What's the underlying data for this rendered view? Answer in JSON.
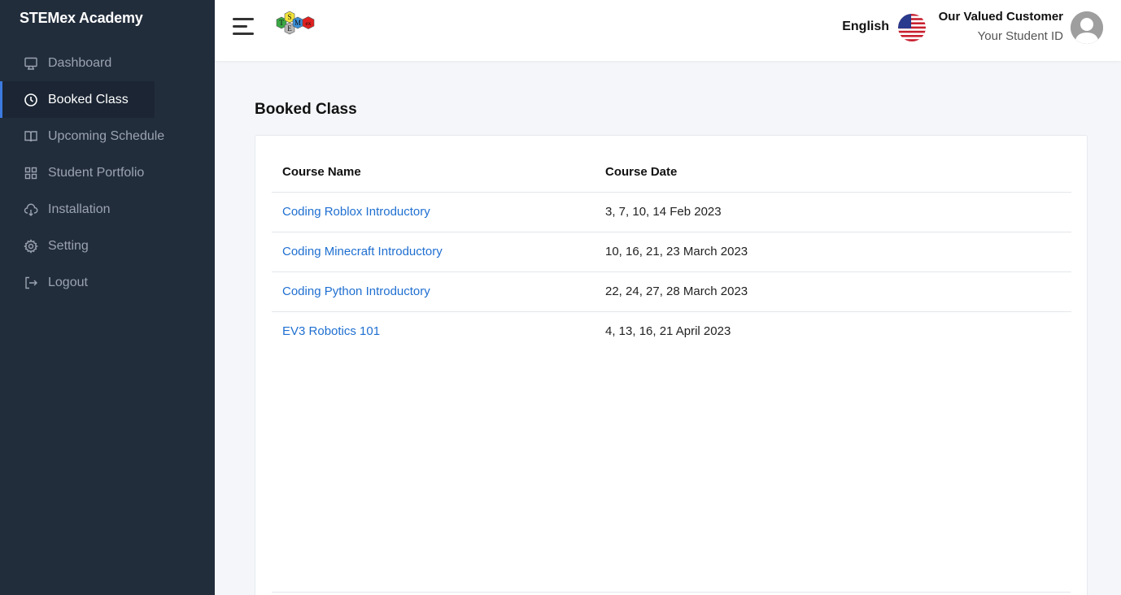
{
  "sidebar": {
    "brand": "STEMex Academy",
    "items": [
      {
        "label": "Dashboard",
        "icon": "monitor-icon",
        "active": false
      },
      {
        "label": "Booked Class",
        "icon": "clock-icon",
        "active": true
      },
      {
        "label": "Upcoming Schedule",
        "icon": "book-icon",
        "active": false
      },
      {
        "label": "Student Portfolio",
        "icon": "grid-icon",
        "active": false
      },
      {
        "label": "Installation",
        "icon": "cloud-download-icon",
        "active": false
      },
      {
        "label": "Setting",
        "icon": "gear-icon",
        "active": false
      },
      {
        "label": "Logout",
        "icon": "logout-icon",
        "active": false
      }
    ]
  },
  "header": {
    "logo_letters": [
      "T",
      "S",
      "E",
      "M",
      "ex"
    ],
    "language": "English",
    "user_name": "Our Valued Customer",
    "student_id": "Your Student ID"
  },
  "main": {
    "title": "Booked Class",
    "columns": [
      "Course Name",
      "Course Date"
    ],
    "rows": [
      {
        "course": "Coding Roblox Introductory",
        "date": "3, 7, 10, 14 Feb 2023"
      },
      {
        "course": "Coding Minecraft Introductory",
        "date": "10, 16, 21, 23 March 2023"
      },
      {
        "course": "Coding Python Introductory",
        "date": "22, 24, 27, 28 March 2023"
      },
      {
        "course": "EV3 Robotics 101",
        "date": "4, 13, 16, 21 April 2023"
      }
    ]
  },
  "colors": {
    "sidebar_bg": "#222d3c",
    "accent": "#3c7ae0",
    "link": "#1f6fd1"
  }
}
